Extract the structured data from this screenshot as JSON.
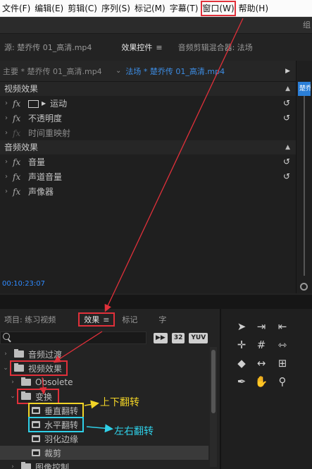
{
  "menubar": {
    "items": [
      "文件(F)",
      "编辑(E)",
      "剪辑(C)",
      "序列(S)",
      "标记(M)",
      "字幕(T)",
      "窗口(W)",
      "帮助(H)"
    ]
  },
  "topstrip": {
    "edge_text": "组"
  },
  "panel_tabs": {
    "source": "源: 楚乔传 01_高清.mp4",
    "effect_controls": "效果控件",
    "audio_mixer": "音频剪辑混合器: 法场"
  },
  "effect_controls": {
    "master_clip": "主要 * 楚乔传 01_高清.mp4",
    "sequence_clip": "法场 * 楚乔传 01_高清.mp4",
    "video_section": "视频效果",
    "video_effects": [
      {
        "name": "运动",
        "dim": false,
        "reset": true
      },
      {
        "name": "不透明度",
        "dim": false,
        "reset": true
      },
      {
        "name": "时间重映射",
        "dim": true,
        "reset": false
      }
    ],
    "audio_section": "音频效果",
    "audio_effects": [
      {
        "name": "音量",
        "dim": false,
        "reset": true
      },
      {
        "name": "声道音量",
        "dim": false,
        "reset": true
      },
      {
        "name": "声像器",
        "dim": false,
        "reset": false
      }
    ],
    "fx_label": "fx",
    "timecode": "00:10:23:07"
  },
  "timeline_strip": {
    "clip_label": "楚乔"
  },
  "project_panel": {
    "tabs": [
      "项目: 练习视频",
      "效果",
      "标记",
      "字"
    ],
    "badges": [
      "32",
      "YUV"
    ],
    "tree": [
      {
        "label": "音频过渡",
        "level": 0,
        "type": "folder",
        "arrow": "›"
      },
      {
        "label": "视频效果",
        "level": 0,
        "type": "folder",
        "arrow": "⌄"
      },
      {
        "label": "Obsolete",
        "level": 1,
        "type": "folder",
        "arrow": "›"
      },
      {
        "label": "变换",
        "level": 1,
        "type": "folder",
        "arrow": "⌄"
      },
      {
        "label": "垂直翻转",
        "level": 2,
        "type": "fx",
        "arrow": ""
      },
      {
        "label": "水平翻转",
        "level": 2,
        "type": "fx",
        "arrow": ""
      },
      {
        "label": "羽化边缘",
        "level": 2,
        "type": "fx",
        "arrow": ""
      },
      {
        "label": "裁剪",
        "level": 2,
        "type": "fx",
        "arrow": ""
      },
      {
        "label": "图像控制",
        "level": 1,
        "type": "folder",
        "arrow": "›"
      }
    ]
  },
  "annotations": {
    "vertical_flip": "上下翻转",
    "horizontal_flip": "左右翻转"
  },
  "colors": {
    "highlight_red": "#e0303a",
    "annotation_yellow": "#f2d427",
    "annotation_cyan": "#2fd0e8",
    "accent_blue": "#2f8bff"
  }
}
